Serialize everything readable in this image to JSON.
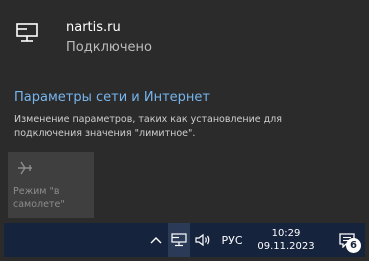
{
  "network": {
    "name": "nartis.ru",
    "status": "Подключено",
    "icon": "ethernet-icon"
  },
  "settings": {
    "link": "Параметры сети и Интернет",
    "description": "Изменение параметров, таких как установление для подключения значения \"лимитное\"."
  },
  "airplane_tile": {
    "label": "Режим \"в самолете\"",
    "icon": "airplane-icon",
    "enabled": false
  },
  "taskbar": {
    "language": "РУС",
    "time": "10:29",
    "date": "09.11.2023",
    "notifications_count": "6"
  },
  "colors": {
    "panel_bg": "#2b2b2b",
    "link": "#77b5ee",
    "taskbar_bg": "#15233d"
  }
}
